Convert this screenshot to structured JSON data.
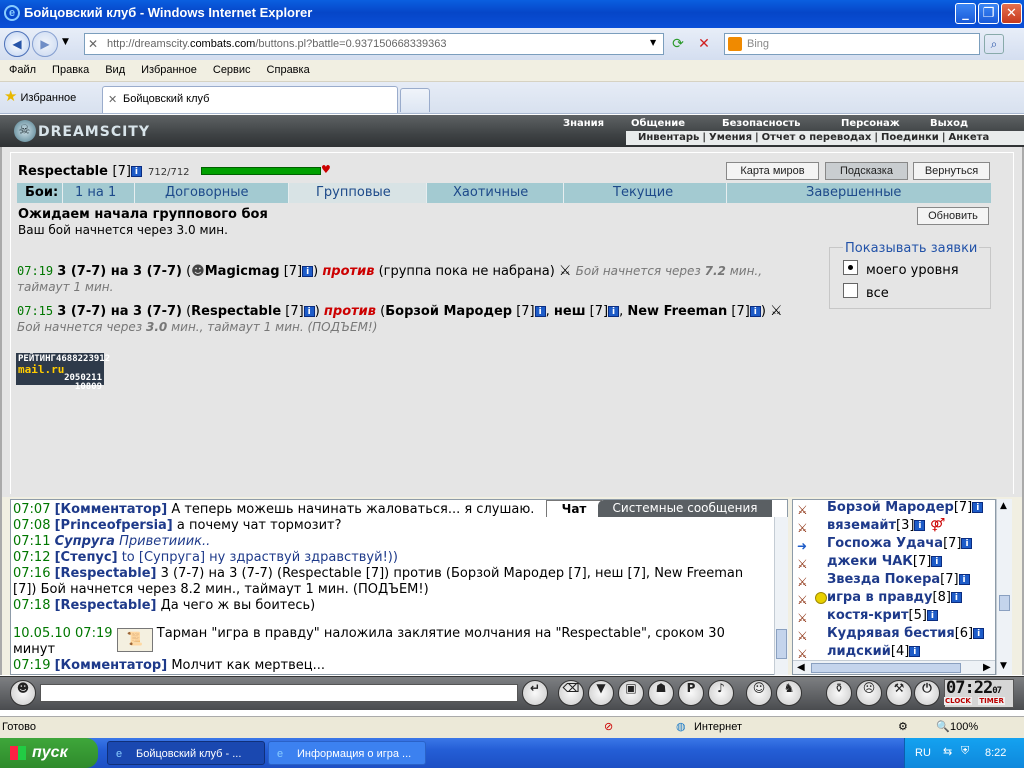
{
  "window": {
    "title": "Бойцовский клуб - Windows Internet Explorer"
  },
  "browser": {
    "url_prefix": "http://dreamscity.",
    "url_domain": "combats.com",
    "url_path": "/buttons.pl?battle=0.937150668339363",
    "search_placeholder": "Bing",
    "menu": [
      "Файл",
      "Правка",
      "Вид",
      "Избранное",
      "Сервис",
      "Справка"
    ],
    "favorites_label": "Избранное",
    "tab_title": "Бойцовский клуб"
  },
  "game": {
    "logo": "DREAMSCITY",
    "topnav": [
      "Знания",
      "Общение",
      "Безопасность",
      "Персонаж",
      "Выход"
    ],
    "subnav": [
      "Инвентарь",
      "Умения",
      "Отчет о переводах",
      "Поединки",
      "Анкета"
    ],
    "player": {
      "name": "Respectable",
      "level": "[7]",
      "hp": "712/712",
      "hp_fraction": 1.0
    },
    "buttons": {
      "map": "Карта миров",
      "hint": "Подсказка",
      "back": "Вернуться",
      "refresh": "Обновить"
    },
    "fight_nav": {
      "label": "Бои:",
      "items": [
        "1 на 1",
        "Договорные",
        "Групповые",
        "Хаотичные",
        "Текущие",
        "Завершенные"
      ],
      "active": "Групповые"
    },
    "status_title": "Ожидаем начала группового боя",
    "status_sub": "Ваш бой начнется через 3.0 мин.",
    "battles": [
      {
        "time": "07:19",
        "team1": "3 (7-7) на 3 (7-7)",
        "leader": "Magicmag",
        "leader_level": "[7]",
        "vs": "против",
        "opponents_text": "(группа пока не набрана)",
        "status_prefix": "Бой начнется через",
        "status_time": "7.2",
        "status_suffix": "мин.,",
        "timeout": "таймаут 1 мин."
      },
      {
        "time": "07:15",
        "team1": "3 (7-7) на 3 (7-7)",
        "leader": "Respectable",
        "leader_level": "[7]",
        "vs": "против",
        "opponents": [
          {
            "name": "Борзой Мародер",
            "level": "[7]"
          },
          {
            "name": "неш",
            "level": "[7]"
          },
          {
            "name": "New Freeman",
            "level": "[7]"
          }
        ],
        "status_prefix": "Бой начнется через",
        "status_time": "3.0",
        "status_suffix": "мин., таймаут 1 мин. (ПОДЪЕМ!)"
      }
    ],
    "filter": {
      "title": "Показывать заявки",
      "options": [
        "моего уровня",
        "все"
      ],
      "selected": "моего уровня"
    },
    "counter": {
      "label": "РЕЙТИНГ",
      "line1": "4688223912",
      "brand": "mail.ru",
      "line2": "2050211",
      "line3": "10809"
    }
  },
  "chat": {
    "tabs": {
      "chat": "Чат",
      "system": "Системные сообщения"
    },
    "messages": [
      {
        "time": "07:07",
        "name": "[Комментатор]",
        "text": "А теперь можешь начинать жаловаться... я слушаю."
      },
      {
        "time": "07:08",
        "name": "[Princeofpersia]",
        "text": "а почему чат тормозит?"
      },
      {
        "time": "07:11",
        "name": "Супруга",
        "text": "Приветииик.."
      },
      {
        "time": "07:12",
        "name": "[Степус]",
        "to": "to [Супруга]",
        "text": "ну здраствуй здравствуй!))"
      },
      {
        "time": "07:16",
        "name": "[Respectable]",
        "text": "3 (7-7) на 3 (7-7) (Respectable [7]) против (Борзой Мародер [7], неш [7], New Freeman",
        "text2": "[7]) Бой начнется через 8.2 мин., таймаут 1 мин. (ПОДЪЕМ!)"
      },
      {
        "time": "07:18",
        "name": "[Respectable]",
        "text": "Да чего ж вы боитесь)"
      },
      {
        "time": "10.05.10  07:19",
        "text": "Тарман \"игра в правду\" наложила заклятие молчания на \"Respectable\", сроком 30",
        "text2": "минут"
      },
      {
        "time": "07:19",
        "name": "[Комментатор]",
        "text": "Молчит как мертвец..."
      }
    ],
    "users": [
      {
        "name": "Борзой Мародер",
        "level": "[7]"
      },
      {
        "name": "вяземайт",
        "level": "[3]"
      },
      {
        "name": "Госпожа Удача",
        "level": "[7]"
      },
      {
        "name": "джеки ЧАК",
        "level": "[7]"
      },
      {
        "name": "Звезда Покера",
        "level": "[7]"
      },
      {
        "name": "игра в правду",
        "level": "[8]"
      },
      {
        "name": "костя-крит",
        "level": "[5]"
      },
      {
        "name": "Кудрявая бестия",
        "level": "[6]"
      },
      {
        "name": "лидский",
        "level": "[4]"
      }
    ]
  },
  "toolbar": {
    "clock": "07:22",
    "clock_sec": "07",
    "clock_label": "CLOCK",
    "timer_label": "TIMER"
  },
  "statusbar": {
    "left": "Готово",
    "zone": "Интернет",
    "zoom": "100%"
  },
  "taskbar": {
    "start": "пуск",
    "tasks": [
      "Бойцовский клуб - ...",
      "Информация о игра ..."
    ],
    "lang": "RU",
    "time": "8:22"
  }
}
